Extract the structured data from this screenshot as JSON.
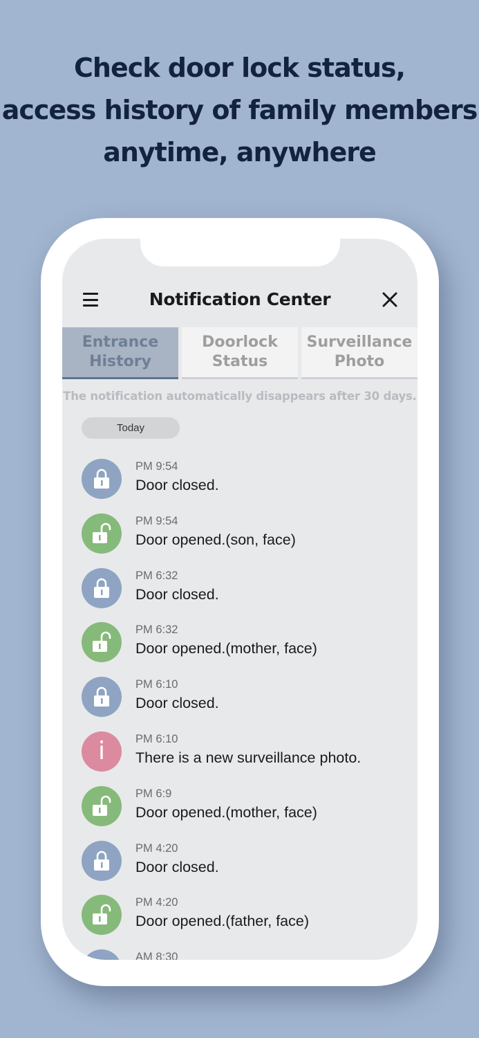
{
  "headline": {
    "line1": "Check door lock status,",
    "line2": "access history of family members",
    "line3": "anytime, anywhere"
  },
  "header": {
    "title": "Notification Center",
    "menu_icon": "hamburger-menu-icon",
    "close_icon": "close-icon"
  },
  "tabs": [
    {
      "line1": "Entrance",
      "line2": "History",
      "active": true
    },
    {
      "line1": "Doorlock",
      "line2": "Status",
      "active": false
    },
    {
      "line1": "Surveillance",
      "line2": "Photo",
      "active": false
    }
  ],
  "notice": "The notification automatically disappears after 30 days.",
  "today_label": "Today",
  "colors": {
    "locked": "#8ea4c2",
    "unlocked": "#86ba7a",
    "info": "#dc8aa0",
    "active_tab": "#a8b4c3"
  },
  "notifications": [
    {
      "time": "PM 9:54",
      "message": "Door closed.",
      "icon": "lock-closed-icon"
    },
    {
      "time": "PM 9:54",
      "message": "Door opened.(son, face)",
      "icon": "lock-open-icon"
    },
    {
      "time": "PM 6:32",
      "message": "Door closed.",
      "icon": "lock-closed-icon"
    },
    {
      "time": "PM 6:32",
      "message": "Door opened.(mother, face)",
      "icon": "lock-open-icon"
    },
    {
      "time": "PM 6:10",
      "message": "Door closed.",
      "icon": "lock-closed-icon"
    },
    {
      "time": "PM 6:10",
      "message": "There is a new surveillance photo.",
      "icon": "info-icon"
    },
    {
      "time": "PM 6:9",
      "message": "Door opened.(mother, face)",
      "icon": "lock-open-icon"
    },
    {
      "time": "PM 4:20",
      "message": "Door closed.",
      "icon": "lock-closed-icon"
    },
    {
      "time": "PM 4:20",
      "message": "Door opened.(father, face)",
      "icon": "lock-open-icon"
    },
    {
      "time": "AM 8:30",
      "message": "",
      "icon": "lock-closed-icon"
    }
  ]
}
